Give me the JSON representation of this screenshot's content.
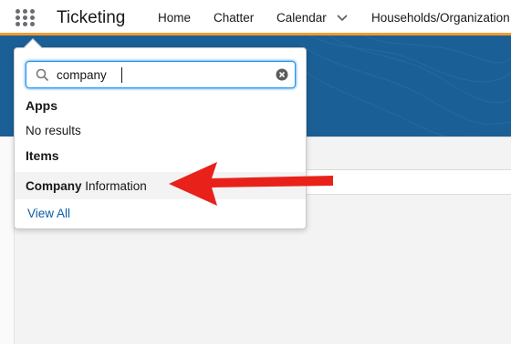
{
  "header": {
    "app_name": "Ticketing",
    "nav": {
      "home": "Home",
      "chatter": "Chatter",
      "calendar": "Calendar",
      "households": "Households/Organization"
    },
    "accent_color": "#f49b2b"
  },
  "search": {
    "value": "company",
    "placeholder": ""
  },
  "results": {
    "apps_heading": "Apps",
    "apps_empty": "No results",
    "items_heading": "Items",
    "items": [
      {
        "match": "Company",
        "rest": " Information"
      }
    ],
    "view_all": "View All"
  },
  "annotation": {
    "arrow_color": "#e8221a"
  },
  "icons": [
    "app-launcher-icon",
    "chevron-down-icon",
    "search-icon",
    "clear-icon"
  ]
}
